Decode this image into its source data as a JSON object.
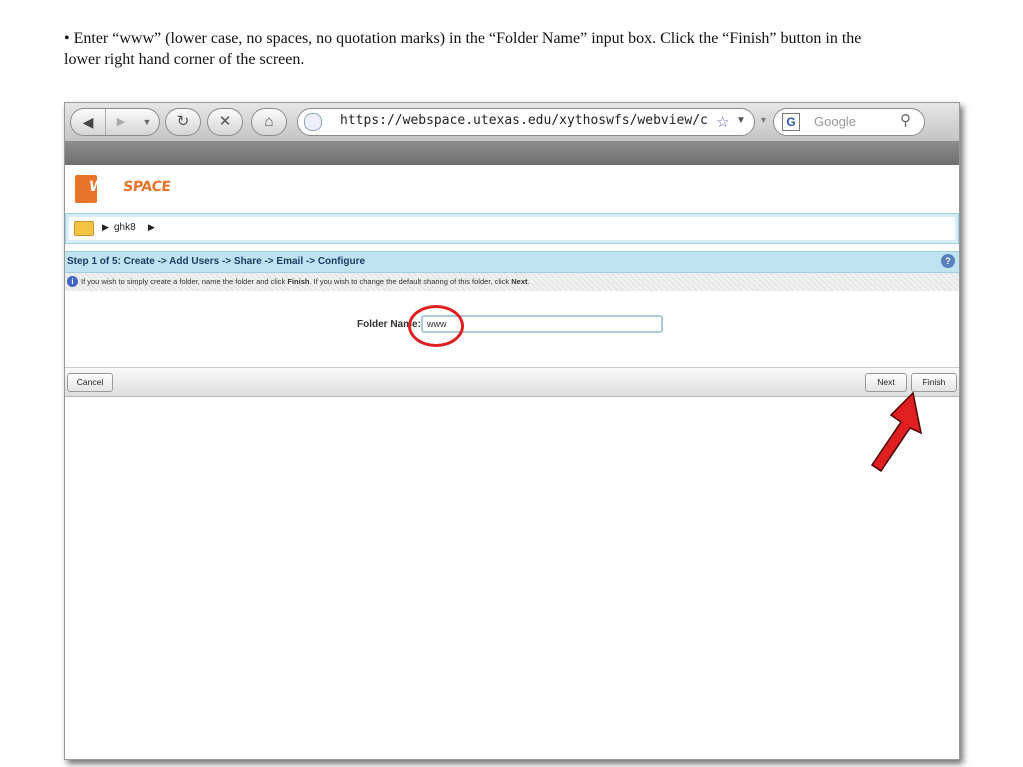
{
  "instruction": "• Enter “www” (lower case, no spaces, no quotation marks) in the “Folder Name” input box. Click the “Finish” button in the lower right hand corner of the screen.",
  "browser": {
    "url": "https://webspace.utexas.edu/xythoswfs/webview/createFold",
    "search_placeholder": "Google",
    "search_engine_letter": "G"
  },
  "app": {
    "logo_text_white": "WEB",
    "logo_text_color": "SPACE",
    "breadcrumb": [
      "ghk8"
    ]
  },
  "wizard": {
    "step_text": "Step 1 of 5: Create -> Add Users -> Share -> Email -> Configure",
    "info_text_plain1": "If you wish to simply create a folder, name the folder and click ",
    "info_bold1": "Finish",
    "info_text_plain2": ". If you wish to change the default sharing of this folder, click ",
    "info_bold2": "Next",
    "info_text_plain3": ".",
    "folder_label": "Folder Name:",
    "folder_value": "www",
    "cancel_label": "Cancel",
    "next_label": "Next",
    "finish_label": "Finish"
  },
  "colors": {
    "annotation": "#e02020",
    "accent": "#e8742a",
    "step_bar": "#bfe3f0"
  }
}
